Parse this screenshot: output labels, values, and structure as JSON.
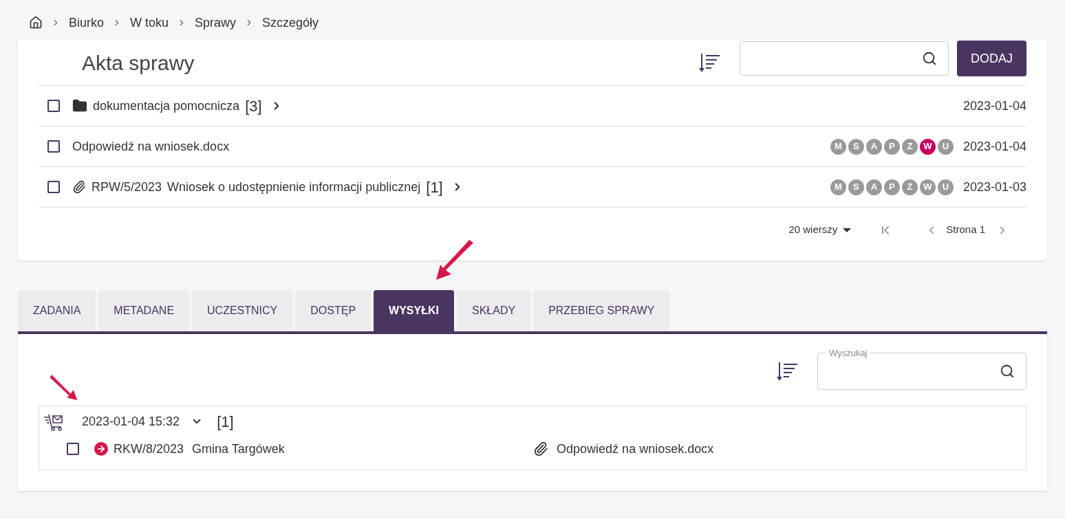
{
  "breadcrumb": [
    "Biurko",
    "W toku",
    "Sprawy",
    "Szczegóły"
  ],
  "files": {
    "title": "Akta sprawy",
    "add_button": "DODAJ",
    "rows": [
      {
        "kind": "folder",
        "checked": false,
        "ref": "",
        "name": "dokumentacja pomocnicza",
        "count": "[3]",
        "expandable": true,
        "badges": [],
        "date": "2023-01-04"
      },
      {
        "kind": "document",
        "checked": false,
        "ref": "",
        "name": "Odpowiedź na wniosek.docx",
        "count": "",
        "expandable": false,
        "badges": [
          {
            "letter": "M",
            "on": false
          },
          {
            "letter": "S",
            "on": false
          },
          {
            "letter": "A",
            "on": false
          },
          {
            "letter": "P",
            "on": false
          },
          {
            "letter": "Z",
            "on": false
          },
          {
            "letter": "W",
            "on": true
          },
          {
            "letter": "U",
            "on": false
          }
        ],
        "date": "2023-01-04"
      },
      {
        "kind": "attachment",
        "checked": false,
        "ref": "RPW/5/2023",
        "name": "Wniosek o udostępnienie informacji publicznej",
        "count": "[1]",
        "expandable": true,
        "badges": [
          {
            "letter": "M",
            "on": false
          },
          {
            "letter": "S",
            "on": false
          },
          {
            "letter": "A",
            "on": false
          },
          {
            "letter": "P",
            "on": false
          },
          {
            "letter": "Z",
            "on": false
          },
          {
            "letter": "W",
            "on": false
          },
          {
            "letter": "U",
            "on": false
          }
        ],
        "date": "2023-01-03"
      }
    ],
    "pagination": {
      "rows_per_page": "20 wierszy",
      "page": "Strona 1"
    }
  },
  "tabs": [
    {
      "label": "ZADANIA",
      "selected": false
    },
    {
      "label": "METADANE",
      "selected": false
    },
    {
      "label": "UCZESTNICY",
      "selected": false
    },
    {
      "label": "DOSTĘP",
      "selected": false
    },
    {
      "label": "WYSYŁKI",
      "selected": true
    },
    {
      "label": "SKŁADY",
      "selected": false
    },
    {
      "label": "PRZEBIEG SPRAWY",
      "selected": false
    }
  ],
  "shipments": {
    "search_label": "Wyszukaj",
    "groups": [
      {
        "date": "2023-01-04 15:32",
        "count": "[1]",
        "expanded": true,
        "items": [
          {
            "checked": false,
            "ref": "RKW/8/2023",
            "recipient": "Gmina Targówek",
            "attachment": "Odpowiedź na wniosek.docx"
          }
        ]
      }
    ]
  }
}
